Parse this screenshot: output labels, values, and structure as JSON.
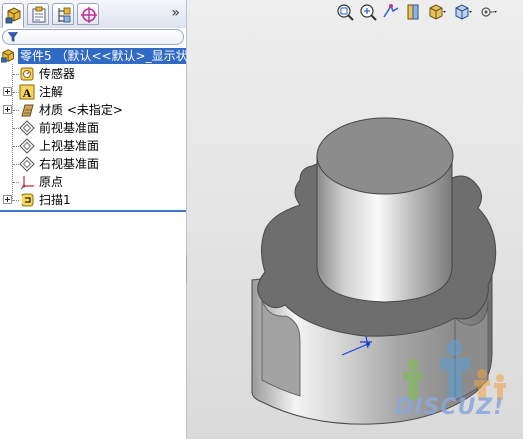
{
  "panel": {
    "collapse_label": "»",
    "tabs": [
      {
        "name": "feature-manager"
      },
      {
        "name": "property-manager"
      },
      {
        "name": "configuration-manager"
      },
      {
        "name": "display-manager"
      }
    ]
  },
  "tree": {
    "root": "零件5 （默认<<默认>_显示状态",
    "items": [
      {
        "label": "传感器",
        "icon": "sensor-icon",
        "expandable": false
      },
      {
        "label": "注解",
        "icon": "annotation-icon",
        "expandable": true
      },
      {
        "label": "材质 <未指定>",
        "icon": "material-icon",
        "expandable": true
      },
      {
        "label": "前视基准面",
        "icon": "plane-icon",
        "expandable": false
      },
      {
        "label": "上视基准面",
        "icon": "plane-icon",
        "expandable": false
      },
      {
        "label": "右视基准面",
        "icon": "plane-icon",
        "expandable": false
      },
      {
        "label": "原点",
        "icon": "origin-icon",
        "expandable": false
      },
      {
        "label": "扫描1",
        "icon": "sweep-feature-icon",
        "expandable": true
      }
    ]
  },
  "viewport": {
    "background_top": "#eeeeee",
    "background_bottom": "#dadada",
    "heads_up_toolbar": [
      "zoom-to-fit-icon",
      "zoom-to-area-icon",
      "previous-view-icon",
      "section-view-icon",
      "view-orientation-icon",
      "display-style-icon",
      "hide-show-items-icon"
    ],
    "watermark": "DISCUZ!"
  },
  "colors": {
    "selection": "#316ac5",
    "tree_border": "#3b74c9"
  }
}
